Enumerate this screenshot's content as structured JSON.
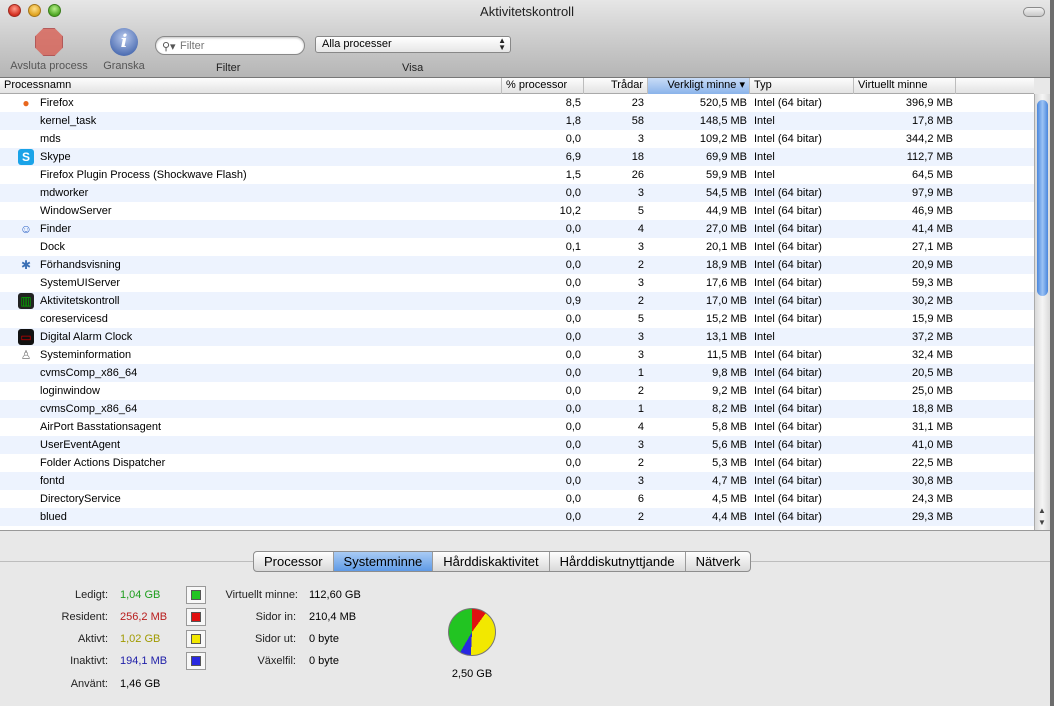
{
  "window": {
    "title": "Aktivitetskontroll"
  },
  "toolbar": {
    "quit_label": "Avsluta process",
    "inspect_label": "Granska",
    "filter_placeholder": "Filter",
    "filter_label": "Filter",
    "view_select": "Alla processer",
    "view_label": "Visa"
  },
  "table": {
    "columns": {
      "name": "Processnamn",
      "cpu": "% processor",
      "threads": "Trådar",
      "real_mem": "Verkligt minne ▾",
      "type": "Typ",
      "virt_mem": "Virtuellt minne"
    },
    "rows": [
      {
        "icon": "firefox-icon",
        "name": "Firefox",
        "cpu": "8,5",
        "threads": "23",
        "mem": "520,5 MB",
        "type": "Intel (64 bitar)",
        "vmem": "396,9 MB"
      },
      {
        "icon": "",
        "name": "kernel_task",
        "cpu": "1,8",
        "threads": "58",
        "mem": "148,5 MB",
        "type": "Intel",
        "vmem": "17,8 MB"
      },
      {
        "icon": "",
        "name": "mds",
        "cpu": "0,0",
        "threads": "3",
        "mem": "109,2 MB",
        "type": "Intel (64 bitar)",
        "vmem": "344,2 MB"
      },
      {
        "icon": "skype-icon",
        "name": "Skype",
        "cpu": "6,9",
        "threads": "18",
        "mem": "69,9 MB",
        "type": "Intel",
        "vmem": "112,7 MB"
      },
      {
        "icon": "",
        "name": "Firefox Plugin Process (Shockwave Flash)",
        "cpu": "1,5",
        "threads": "26",
        "mem": "59,9 MB",
        "type": "Intel",
        "vmem": "64,5 MB"
      },
      {
        "icon": "",
        "name": "mdworker",
        "cpu": "0,0",
        "threads": "3",
        "mem": "54,5 MB",
        "type": "Intel (64 bitar)",
        "vmem": "97,9 MB"
      },
      {
        "icon": "",
        "name": "WindowServer",
        "cpu": "10,2",
        "threads": "5",
        "mem": "44,9 MB",
        "type": "Intel (64 bitar)",
        "vmem": "46,9 MB"
      },
      {
        "icon": "finder-icon",
        "name": "Finder",
        "cpu": "0,0",
        "threads": "4",
        "mem": "27,0 MB",
        "type": "Intel (64 bitar)",
        "vmem": "41,4 MB"
      },
      {
        "icon": "",
        "name": "Dock",
        "cpu": "0,1",
        "threads": "3",
        "mem": "20,1 MB",
        "type": "Intel (64 bitar)",
        "vmem": "27,1 MB"
      },
      {
        "icon": "preview-icon",
        "name": "Förhandsvisning",
        "cpu": "0,0",
        "threads": "2",
        "mem": "18,9 MB",
        "type": "Intel (64 bitar)",
        "vmem": "20,9 MB"
      },
      {
        "icon": "",
        "name": "SystemUIServer",
        "cpu": "0,0",
        "threads": "3",
        "mem": "17,6 MB",
        "type": "Intel (64 bitar)",
        "vmem": "59,3 MB"
      },
      {
        "icon": "activity-monitor-icon",
        "name": "Aktivitetskontroll",
        "cpu": "0,9",
        "threads": "2",
        "mem": "17,0 MB",
        "type": "Intel (64 bitar)",
        "vmem": "30,2 MB"
      },
      {
        "icon": "",
        "name": "coreservicesd",
        "cpu": "0,0",
        "threads": "5",
        "mem": "15,2 MB",
        "type": "Intel (64 bitar)",
        "vmem": "15,9 MB"
      },
      {
        "icon": "alarm-clock-icon",
        "name": "Digital Alarm Clock",
        "cpu": "0,0",
        "threads": "3",
        "mem": "13,1 MB",
        "type": "Intel",
        "vmem": "37,2 MB"
      },
      {
        "icon": "system-info-icon",
        "name": "Systeminformation",
        "cpu": "0,0",
        "threads": "3",
        "mem": "11,5 MB",
        "type": "Intel (64 bitar)",
        "vmem": "32,4 MB"
      },
      {
        "icon": "",
        "name": "cvmsComp_x86_64",
        "cpu": "0,0",
        "threads": "1",
        "mem": "9,8 MB",
        "type": "Intel (64 bitar)",
        "vmem": "20,5 MB"
      },
      {
        "icon": "",
        "name": "loginwindow",
        "cpu": "0,0",
        "threads": "2",
        "mem": "9,2 MB",
        "type": "Intel (64 bitar)",
        "vmem": "25,0 MB"
      },
      {
        "icon": "",
        "name": "cvmsComp_x86_64",
        "cpu": "0,0",
        "threads": "1",
        "mem": "8,2 MB",
        "type": "Intel (64 bitar)",
        "vmem": "18,8 MB"
      },
      {
        "icon": "",
        "name": "AirPort Basstationsagent",
        "cpu": "0,0",
        "threads": "4",
        "mem": "5,8 MB",
        "type": "Intel (64 bitar)",
        "vmem": "31,1 MB"
      },
      {
        "icon": "",
        "name": "UserEventAgent",
        "cpu": "0,0",
        "threads": "3",
        "mem": "5,6 MB",
        "type": "Intel (64 bitar)",
        "vmem": "41,0 MB"
      },
      {
        "icon": "",
        "name": "Folder Actions Dispatcher",
        "cpu": "0,0",
        "threads": "2",
        "mem": "5,3 MB",
        "type": "Intel (64 bitar)",
        "vmem": "22,5 MB"
      },
      {
        "icon": "",
        "name": "fontd",
        "cpu": "0,0",
        "threads": "3",
        "mem": "4,7 MB",
        "type": "Intel (64 bitar)",
        "vmem": "30,8 MB"
      },
      {
        "icon": "",
        "name": "DirectoryService",
        "cpu": "0,0",
        "threads": "6",
        "mem": "4,5 MB",
        "type": "Intel (64 bitar)",
        "vmem": "24,3 MB"
      },
      {
        "icon": "",
        "name": "blued",
        "cpu": "0,0",
        "threads": "2",
        "mem": "4,4 MB",
        "type": "Intel (64 bitar)",
        "vmem": "29,3 MB"
      }
    ]
  },
  "tabs": [
    "Processor",
    "Systemminne",
    "Hårddiskaktivitet",
    "Hårddiskutnyttjande",
    "Nätverk"
  ],
  "active_tab": "Systemminne",
  "memory": {
    "free_label": "Ledigt:",
    "free_value": "1,04 GB",
    "free_color": "#22c422",
    "wired_label": "Resident:",
    "wired_value": "256,2 MB",
    "wired_color": "#e01010",
    "active_label": "Aktivt:",
    "active_value": "1,02 GB",
    "active_color": "#f2e800",
    "inactive_label": "Inaktivt:",
    "inactive_value": "194,1 MB",
    "inactive_color": "#2828e0",
    "used_label": "Använt:",
    "used_value": "1,46 GB",
    "vm_label": "Virtuellt minne:",
    "vm_value": "112,60 GB",
    "pagein_label": "Sidor in:",
    "pagein_value": "210,4 MB",
    "pageout_label": "Sidor ut:",
    "pageout_value": "0 byte",
    "swap_label": "Växelfil:",
    "swap_value": "0 byte",
    "total": "2,50 GB"
  }
}
